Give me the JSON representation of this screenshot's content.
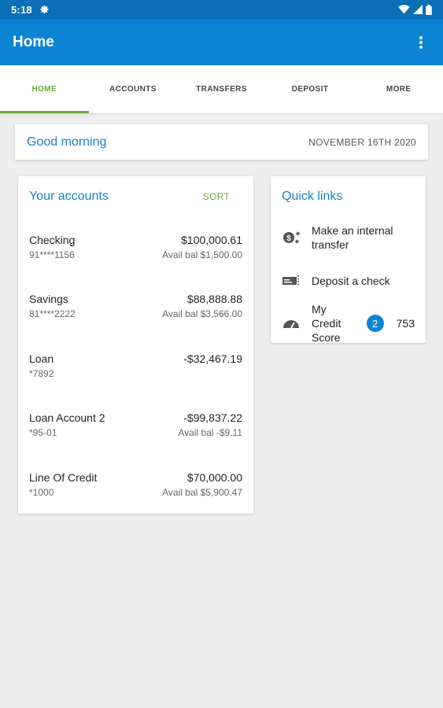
{
  "status_bar": {
    "time": "5:18"
  },
  "app_bar": {
    "title": "Home"
  },
  "tabs": [
    {
      "label": "HOME",
      "active": true
    },
    {
      "label": "ACCOUNTS",
      "active": false
    },
    {
      "label": "TRANSFERS",
      "active": false
    },
    {
      "label": "DEPOSIT",
      "active": false
    },
    {
      "label": "MORE",
      "active": false
    }
  ],
  "greeting": {
    "text": "Good morning",
    "date": "NOVEMBER 16TH 2020"
  },
  "accounts": {
    "title": "Your accounts",
    "sort_label": "SORT",
    "items": [
      {
        "name": "Checking",
        "number": "91****1156",
        "balance": "$100,000.61",
        "avail": "Avail bal $1,500.00"
      },
      {
        "name": "Savings",
        "number": "81****2222",
        "balance": "$88,888.88",
        "avail": "Avail bal $3,566.00"
      },
      {
        "name": "Loan",
        "number": "*7892",
        "balance": "-$32,467.19",
        "avail": ""
      },
      {
        "name": "Loan Account 2",
        "number": "*95-01",
        "balance": "-$99,837.22",
        "avail": "Avail bal -$9.11"
      },
      {
        "name": "Line Of Credit",
        "number": "*1000",
        "balance": "$70,000.00",
        "avail": "Avail bal $5,900.47"
      }
    ]
  },
  "quick_links": {
    "title": "Quick links",
    "items": [
      {
        "label": "Make an internal transfer",
        "icon": "transfer-icon"
      },
      {
        "label": "Deposit a check",
        "icon": "check-deposit-icon"
      },
      {
        "label": "My Credit Score",
        "icon": "gauge-icon",
        "badge": "2",
        "score": "753"
      }
    ]
  },
  "colors": {
    "primary": "#0b84d3",
    "accent": "#6aae3b",
    "link": "#1b80c6"
  }
}
